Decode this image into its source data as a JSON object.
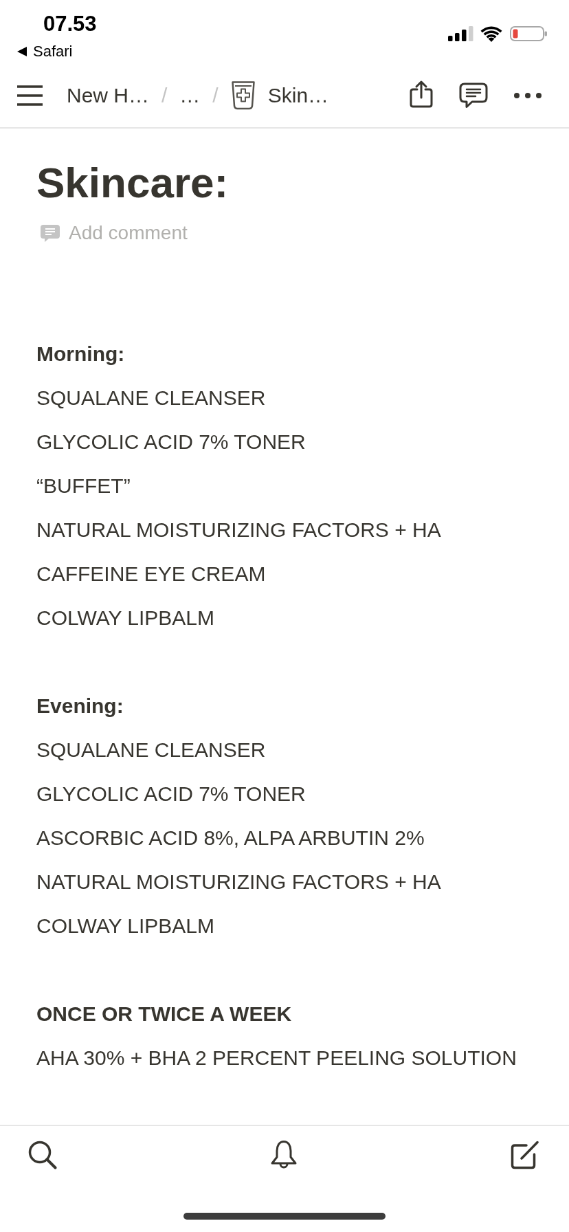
{
  "status_bar": {
    "time": "07.53",
    "back_label": "Safari"
  },
  "nav_bar": {
    "breadcrumbs": [
      {
        "kind": "crumb",
        "label": "New H…"
      },
      {
        "kind": "separator",
        "label": "/"
      },
      {
        "kind": "crumb",
        "label": "…"
      },
      {
        "kind": "separator",
        "label": "/"
      },
      {
        "kind": "page",
        "label": "Skin…"
      }
    ]
  },
  "page": {
    "title": "Skincare:",
    "add_comment": "Add comment",
    "sections": [
      {
        "heading": "Morning:",
        "items": [
          "SQUALANE CLEANSER",
          "GLYCOLIC ACID 7% TONER",
          "“BUFFET”",
          "NATURAL MOISTURIZING FACTORS + HA",
          "CAFFEINE EYE CREAM",
          "COLWAY LIPBALM"
        ]
      },
      {
        "heading": "Evening:",
        "items": [
          "SQUALANE CLEANSER",
          "GLYCOLIC ACID 7% TONER",
          "ASCORBIC ACID 8%, ALPA ARBUTIN 2%",
          "NATURAL MOISTURIZING FACTORS + HA",
          "COLWAY LIPBALM"
        ]
      },
      {
        "heading": "ONCE OR TWICE A WEEK",
        "items": [
          "AHA 30% + BHA 2 PERCENT PEELING SOLUTION"
        ]
      }
    ]
  }
}
